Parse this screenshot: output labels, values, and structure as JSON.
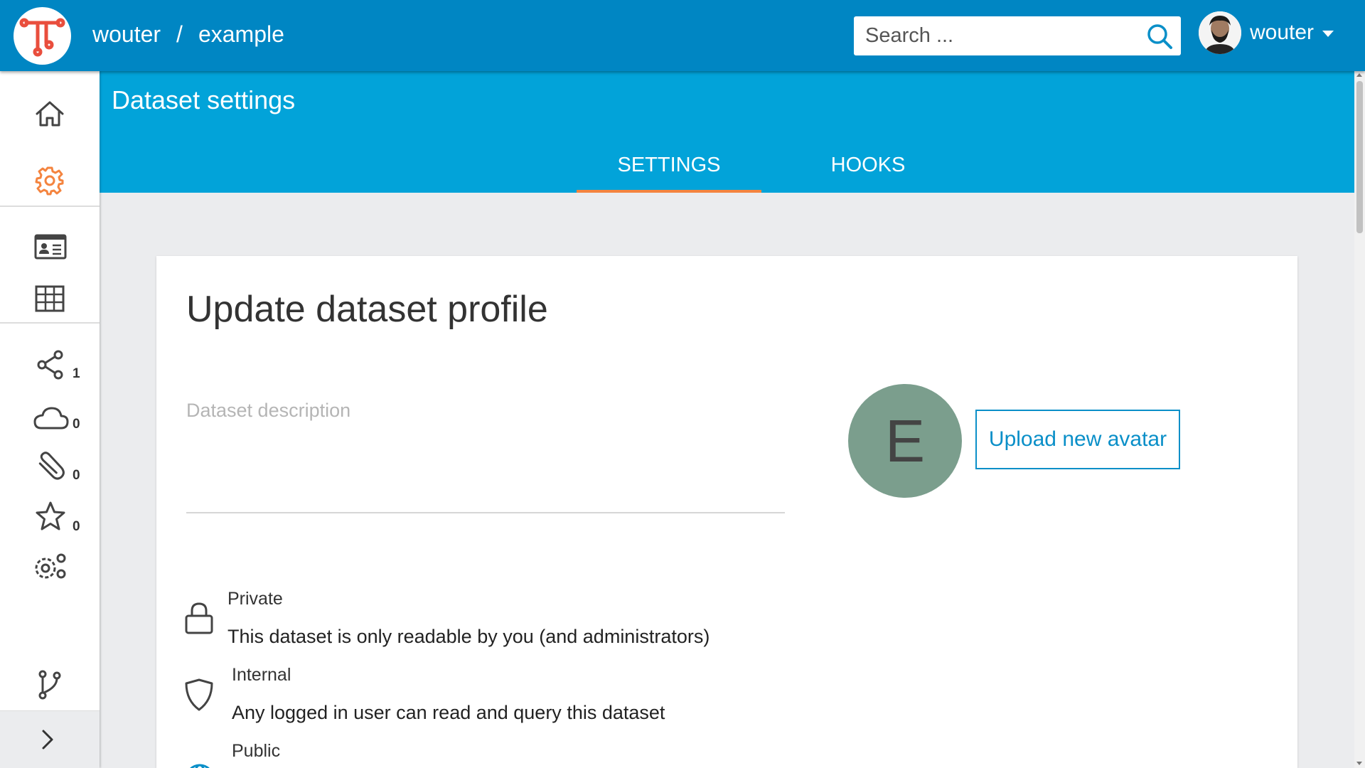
{
  "topbar": {
    "breadcrumb": {
      "owner": "wouter",
      "separator": "/",
      "dataset": "example"
    },
    "search": {
      "placeholder": "Search ...",
      "value": ""
    },
    "user": {
      "name": "wouter"
    }
  },
  "sidebar": {
    "items": [
      {
        "name": "home",
        "icon": "home-icon",
        "count": ""
      },
      {
        "name": "settings",
        "icon": "gear-icon",
        "count": "",
        "active": true
      },
      {
        "name": "info",
        "icon": "id-card-icon",
        "count": ""
      },
      {
        "name": "table",
        "icon": "table-icon",
        "count": ""
      },
      {
        "name": "share",
        "icon": "share-icon",
        "count": "1"
      },
      {
        "name": "services",
        "icon": "cloud-icon",
        "count": "0"
      },
      {
        "name": "assets",
        "icon": "paperclip-icon",
        "count": "0"
      },
      {
        "name": "stories",
        "icon": "star-icon",
        "count": "0"
      },
      {
        "name": "advanced",
        "icon": "gears-icon",
        "count": ""
      },
      {
        "name": "graphs",
        "icon": "branch-icon",
        "count": ""
      }
    ],
    "expand_icon": "chevron-right-icon"
  },
  "header": {
    "title": "Dataset settings",
    "tabs": [
      {
        "label": "SETTINGS",
        "active": true
      },
      {
        "label": "HOOKS",
        "active": false
      }
    ]
  },
  "main": {
    "card_title": "Update dataset profile",
    "description": {
      "placeholder": "Dataset description",
      "value": ""
    },
    "avatar_letter": "E",
    "upload_label": "Upload new avatar",
    "access": [
      {
        "icon": "lock-icon",
        "label": "Private",
        "description": "This dataset is only readable by you (and administrators)"
      },
      {
        "icon": "shield-icon",
        "label": "Internal",
        "description": "Any logged in user can read and query this dataset"
      },
      {
        "icon": "globe-icon",
        "label": "Public",
        "description": ""
      }
    ]
  },
  "colors": {
    "topbar": "#0086c3",
    "header_band": "#02a3d9",
    "accent": "#f4843f",
    "link": "#0a8fc8",
    "avatar_bg": "#7b9e8d"
  }
}
